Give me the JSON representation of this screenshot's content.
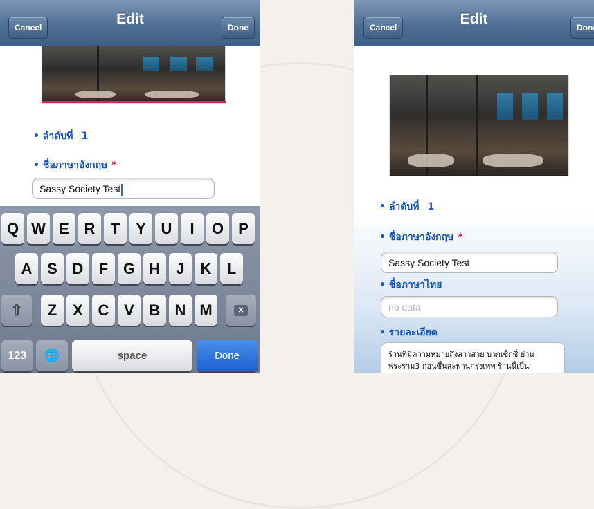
{
  "left": {
    "nav": {
      "cancel": "Cancel",
      "title": "Edit",
      "done": "Done"
    },
    "fields": {
      "order_label": "ลำดับที่",
      "order_value": "1",
      "name_en_label": "ชื่อภาษาอังกฤษ",
      "required_mark": "*",
      "name_en_value": "Sassy  Society Test"
    },
    "keyboard": {
      "row1": [
        "Q",
        "W",
        "E",
        "R",
        "T",
        "Y",
        "U",
        "I",
        "O",
        "P"
      ],
      "row2": [
        "A",
        "S",
        "D",
        "F",
        "G",
        "H",
        "J",
        "K",
        "L"
      ],
      "row3": [
        "Z",
        "X",
        "C",
        "V",
        "B",
        "N",
        "M"
      ],
      "shift": "⇧",
      "delete": "✕",
      "numbers": "123",
      "globe": "🌐",
      "space": "space",
      "done": "Done"
    }
  },
  "right": {
    "nav": {
      "cancel": "Cancel",
      "title": "Edit",
      "done": "Done"
    },
    "fields": {
      "order_label": "ลำดับที่",
      "order_value": "1",
      "name_en_label": "ชื่อภาษาอังกฤษ",
      "required_mark": "*",
      "name_en_value": "Sassy  Society Test",
      "name_th_label": "ชื่อภาษาไทย",
      "name_th_placeholder": "no data",
      "detail_label": "รายละเอียด",
      "detail_value": "ร้านที่มีความหมายถึงสาวสวย บวกเซ็กซี่ ย่านพระราม3 ก่อนขึ้นสะพานกรุงเทพ ร้านนี้เป็น"
    }
  },
  "colors": {
    "nav": "#4f6f94",
    "label": "#1557c2",
    "required": "#e01560",
    "done_key": "#1d5fd1"
  }
}
